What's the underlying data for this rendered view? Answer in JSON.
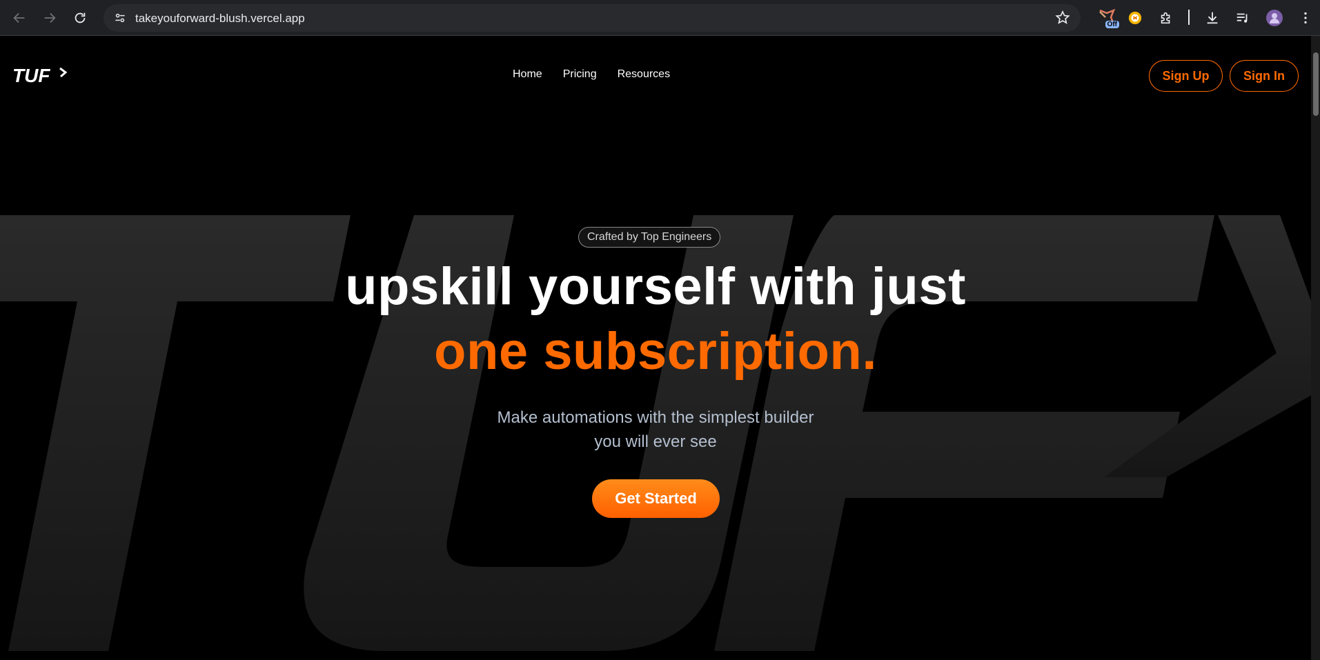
{
  "browser": {
    "url": "takeyouforward-blush.vercel.app",
    "extension_badge": "Off"
  },
  "site": {
    "logo_text": "TUF",
    "nav": [
      {
        "label": "Home"
      },
      {
        "label": "Pricing"
      },
      {
        "label": "Resources"
      }
    ],
    "signup_label": "Sign Up",
    "signin_label": "Sign In"
  },
  "hero": {
    "badge": "Crafted by Top Engineers",
    "headline_line1": "upskill yourself with just",
    "headline_line2": "one subscription.",
    "subtext_line1": "Make automations with the simplest builder",
    "subtext_line2": "you will ever see",
    "cta_label": "Get Started"
  },
  "colors": {
    "accent": "#ff6a00",
    "background": "#000000",
    "chrome": "#202124"
  }
}
